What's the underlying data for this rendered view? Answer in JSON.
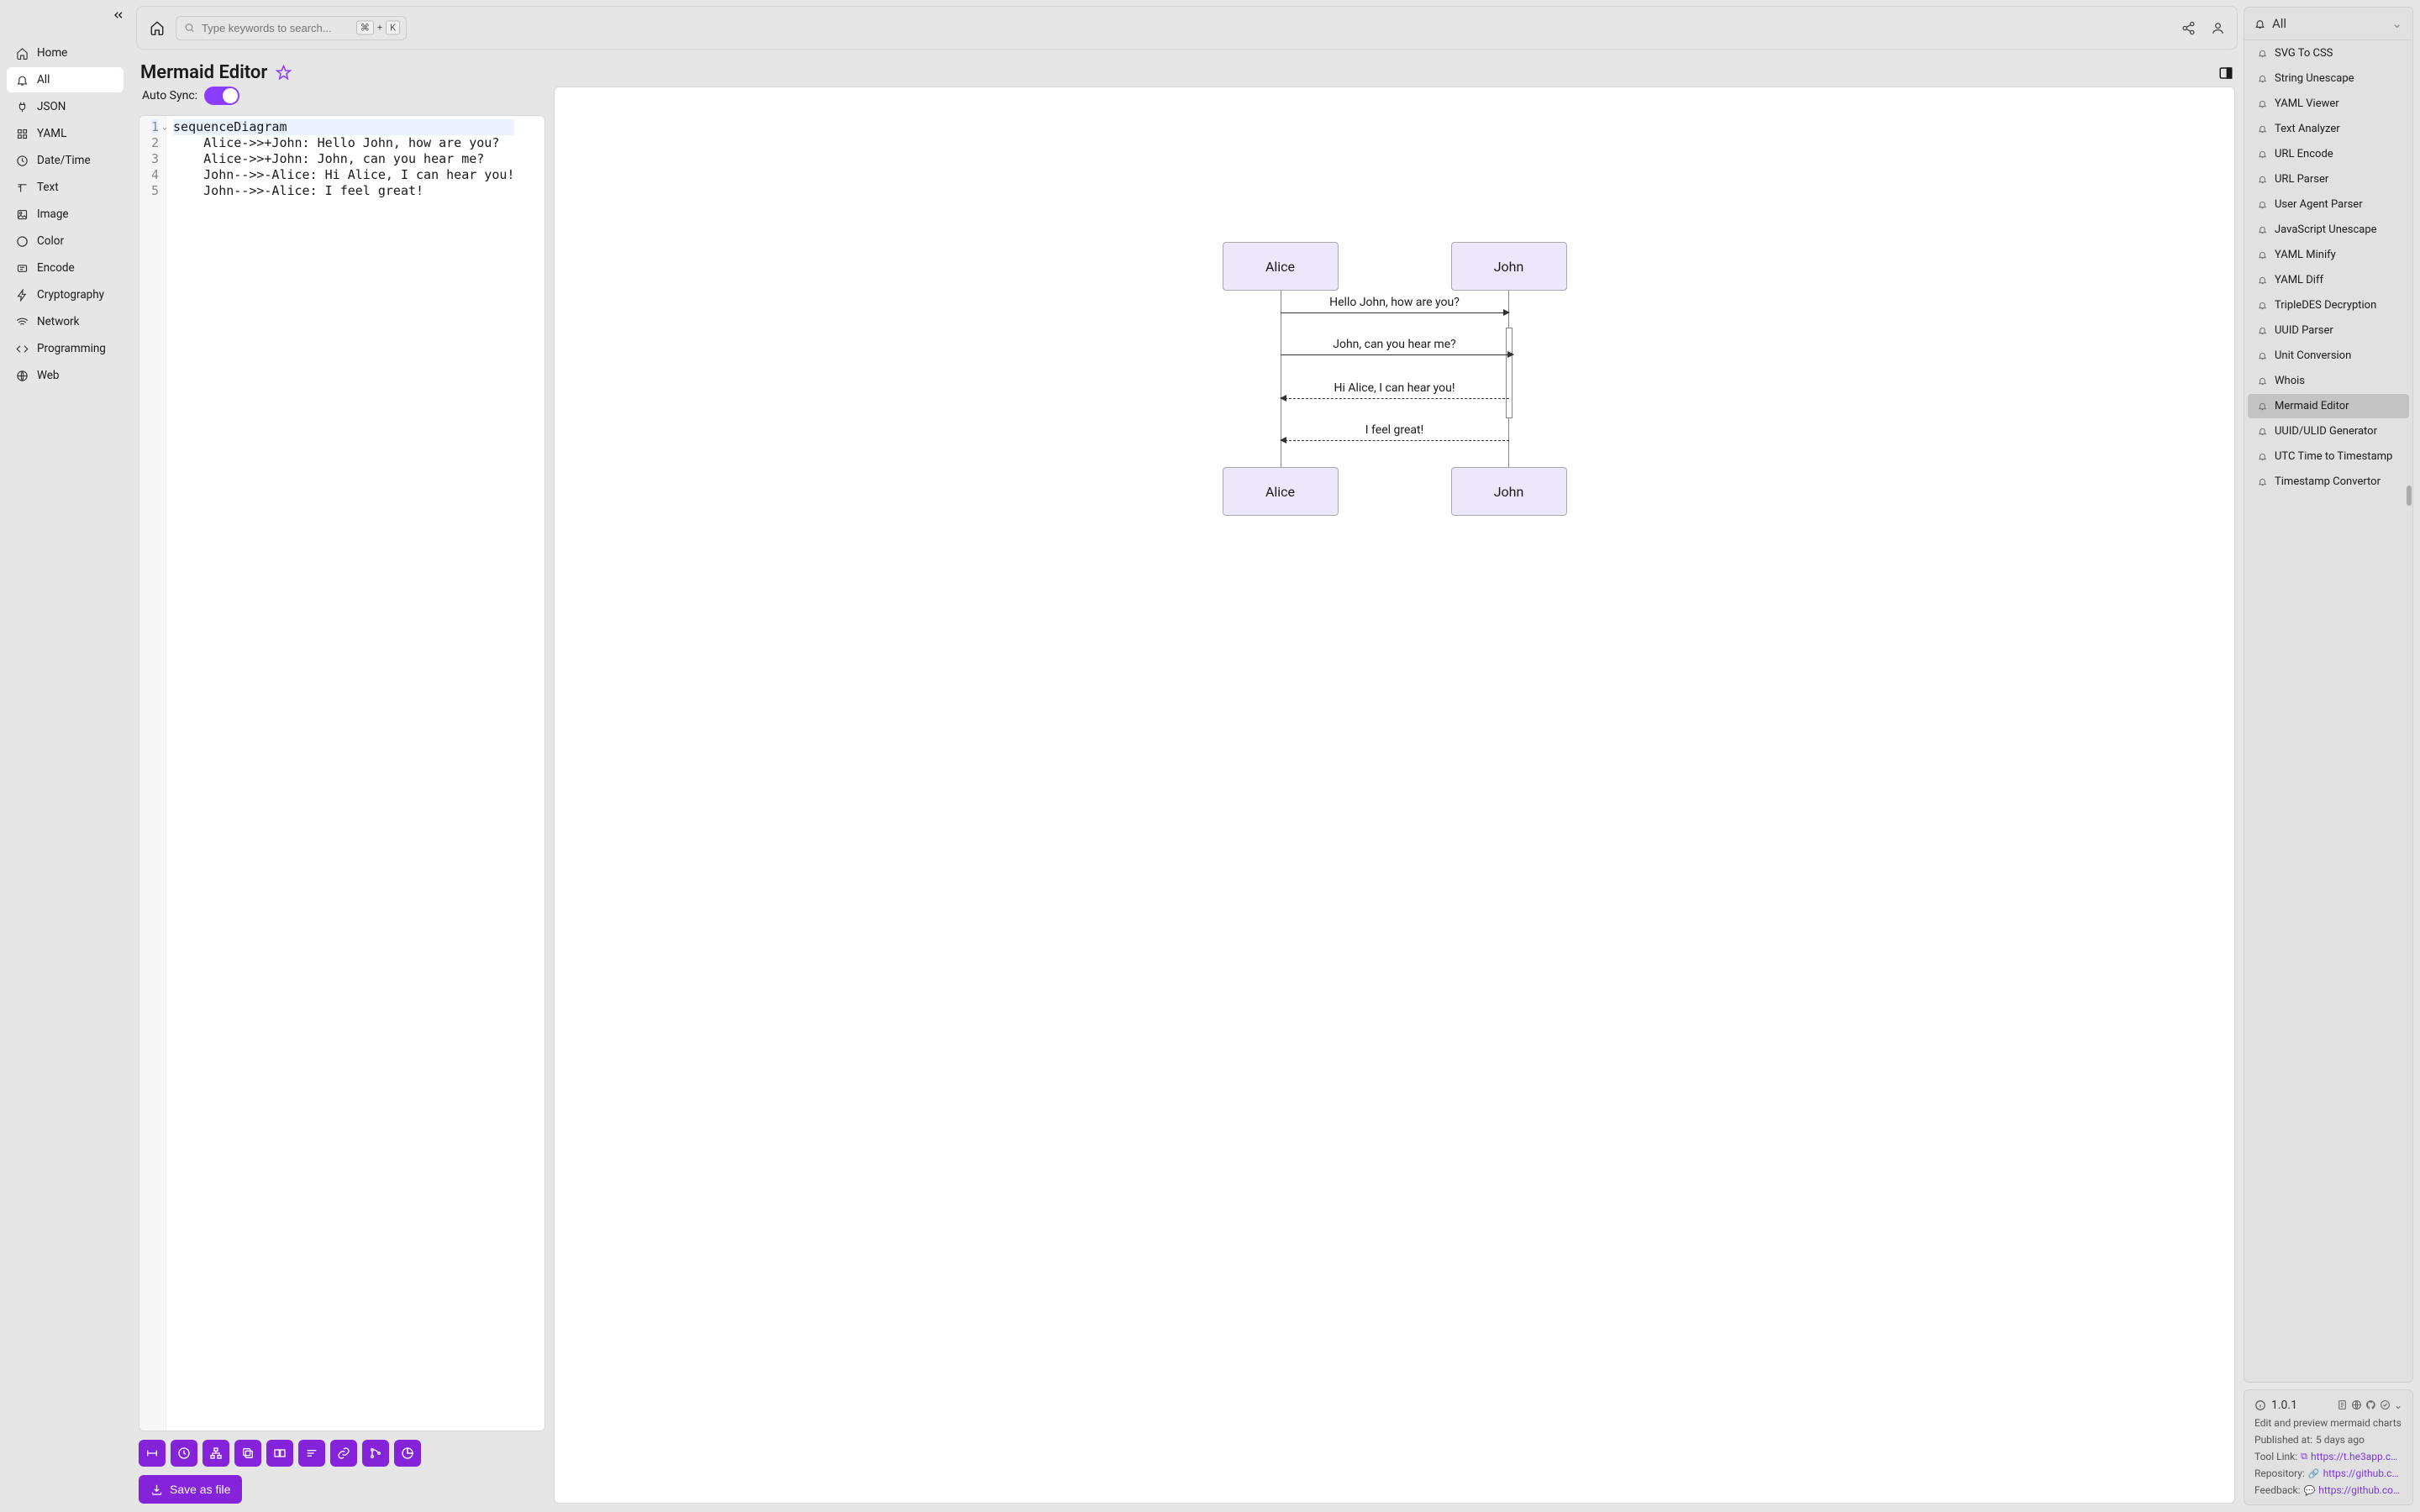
{
  "sidebar_left": {
    "items": [
      {
        "label": "Home",
        "icon": "home"
      },
      {
        "label": "All",
        "icon": "bell",
        "active": true
      },
      {
        "label": "JSON",
        "icon": "plug"
      },
      {
        "label": "YAML",
        "icon": "grid"
      },
      {
        "label": "Date/Time",
        "icon": "clock"
      },
      {
        "label": "Text",
        "icon": "text"
      },
      {
        "label": "Image",
        "icon": "image"
      },
      {
        "label": "Color",
        "icon": "color"
      },
      {
        "label": "Encode",
        "icon": "encode"
      },
      {
        "label": "Cryptography",
        "icon": "bolt"
      },
      {
        "label": "Network",
        "icon": "wifi"
      },
      {
        "label": "Programming",
        "icon": "code"
      },
      {
        "label": "Web",
        "icon": "globe"
      }
    ]
  },
  "search": {
    "placeholder": "Type keywords to search...",
    "shortcut_mod": "⌘",
    "shortcut_plus": "+",
    "shortcut_key": "K"
  },
  "page": {
    "title": "Mermaid Editor"
  },
  "editor": {
    "autosync_label": "Auto Sync:",
    "code_lines": [
      "sequenceDiagram",
      "    Alice->>+John: Hello John, how are you?",
      "    Alice->>+John: John, can you hear me?",
      "    John-->>-Alice: Hi Alice, I can hear you!",
      "    John-->>-Alice: I feel great!"
    ],
    "save_button": "Save as file"
  },
  "diagram": {
    "actor1": "Alice",
    "actor2": "John",
    "messages": [
      "Hello John, how are you?",
      "John, can you hear me?",
      "Hi Alice, I can hear you!",
      "I feel great!"
    ]
  },
  "right_panel": {
    "header": "All",
    "tools": [
      "SVG To CSS",
      "String Unescape",
      "YAML Viewer",
      "Text Analyzer",
      "URL Encode",
      "URL Parser",
      "User Agent Parser",
      "JavaScript Unescape",
      "YAML Minify",
      "YAML Diff",
      "TripleDES Decryption",
      "UUID Parser",
      "Unit Conversion",
      "Whois",
      "Mermaid Editor",
      "UUID/ULID Generator",
      "UTC Time to Timestamp",
      "Timestamp Convertor"
    ],
    "active_tool": "Mermaid Editor"
  },
  "info": {
    "version": "1.0.1",
    "description": "Edit and preview mermaid charts",
    "published_label": "Published at:",
    "published_value": "5 days ago",
    "tool_link_label": "Tool Link:",
    "tool_link": "https://t.he3app.co...",
    "repo_label": "Repository:",
    "repo": "https://github.com...",
    "feedback_label": "Feedback:",
    "feedback": "https://github.com/..."
  }
}
